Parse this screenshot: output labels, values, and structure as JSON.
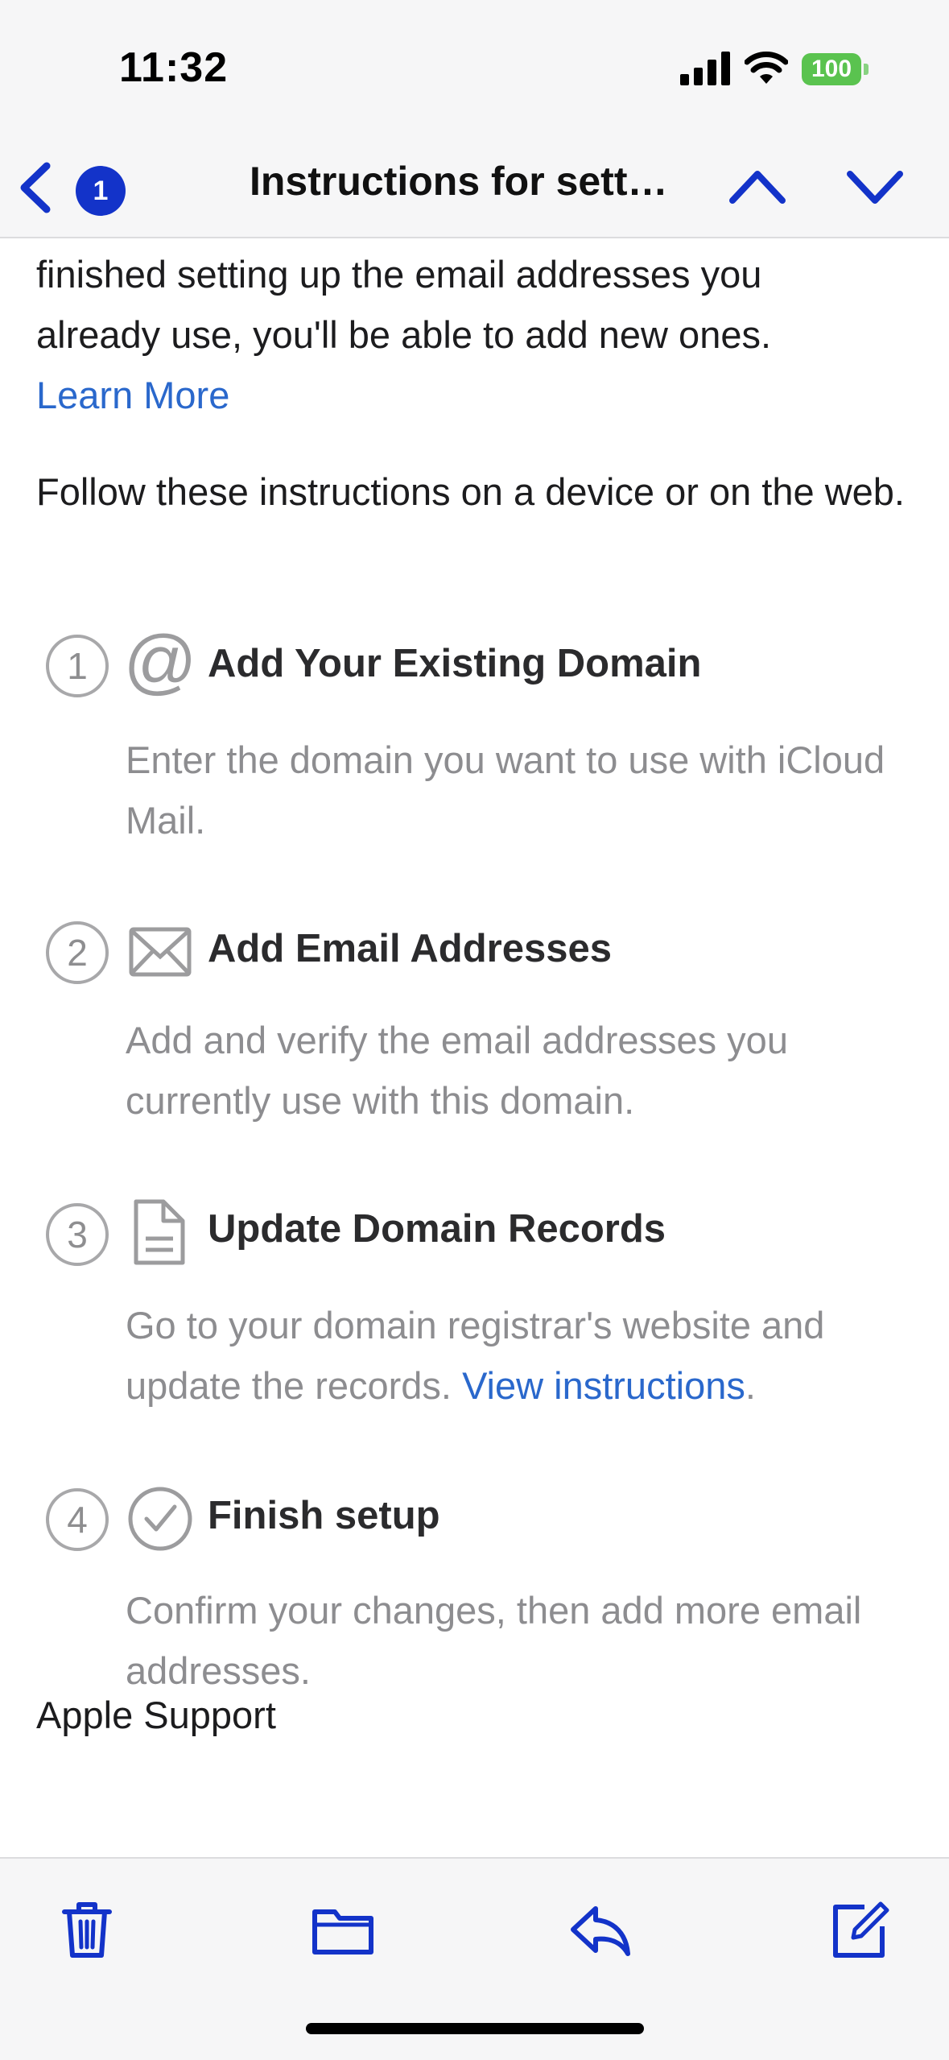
{
  "status_bar": {
    "time": "11:32",
    "battery": "100",
    "battery_color": "#5ac34f"
  },
  "nav": {
    "unread_count": "1",
    "title": "Instructions for sett…",
    "icons": [
      "back-chevron-icon",
      "chevron-up-icon",
      "chevron-down-icon"
    ],
    "accent_color": "#1333c9"
  },
  "message": {
    "intro_line1": "finished setting up the email addresses you",
    "intro_line2": "already use, you'll be able to add new ones.",
    "learn_more": "Learn More",
    "follow_text": "Follow these instructions on a device or on the web.",
    "steps": [
      {
        "number": "1",
        "icon": "at-sign-icon",
        "title": "Add Your Existing Domain",
        "description": "Enter the domain you want to use with iCloud Mail."
      },
      {
        "number": "2",
        "icon": "envelope-icon",
        "title": "Add Email Addresses",
        "description": "Add and verify the email addresses you currently use with this domain."
      },
      {
        "number": "3",
        "icon": "document-icon",
        "title": "Update Domain Records",
        "description": "Go to your domain registrar's website and update the records.",
        "link": "View instructions",
        "link_suffix": "."
      },
      {
        "number": "4",
        "icon": "checkmark-circle-icon",
        "title": "Finish setup",
        "description": "Confirm your changes, then add more email addresses."
      }
    ],
    "signature": "Apple Support",
    "link_color": "#2a68cc"
  },
  "toolbar": {
    "icons": [
      "trash-icon",
      "folder-icon",
      "reply-icon",
      "compose-icon"
    ]
  }
}
